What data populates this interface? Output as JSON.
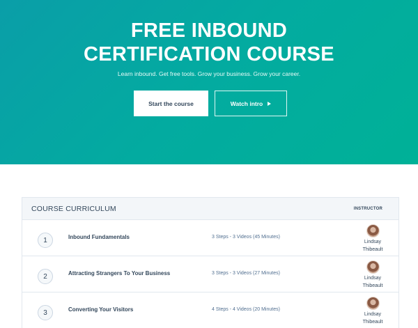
{
  "hero": {
    "title_line1": "FREE INBOUND",
    "title_line2": "CERTIFICATION COURSE",
    "subtitle": "Learn inbound. Get free tools. Grow your business. Grow your career.",
    "primary_button": "Start the course",
    "secondary_button": "Watch intro",
    "secondary_icon": "play-icon",
    "gradient_colors": [
      "#0a9ea8",
      "#00b197"
    ]
  },
  "curriculum": {
    "title": "COURSE CURRICULUM",
    "instructor_header": "INSTRUCTOR",
    "lessons": [
      {
        "number": "1",
        "title": "Inbound Fundamentals",
        "meta": "3 Steps - 3 Videos (45 Minutes)",
        "instructor_first": "Lindsay",
        "instructor_last": "Thibeault"
      },
      {
        "number": "2",
        "title": "Attracting Strangers To Your Business",
        "meta": "3 Steps - 3 Videos (27 Minutes)",
        "instructor_first": "Lindsay",
        "instructor_last": "Thibeault"
      },
      {
        "number": "3",
        "title": "Converting Your Visitors",
        "meta": "4 Steps - 4 Videos (20 Minutes)",
        "instructor_first": "Lindsay",
        "instructor_last": "Thibeault"
      }
    ]
  }
}
